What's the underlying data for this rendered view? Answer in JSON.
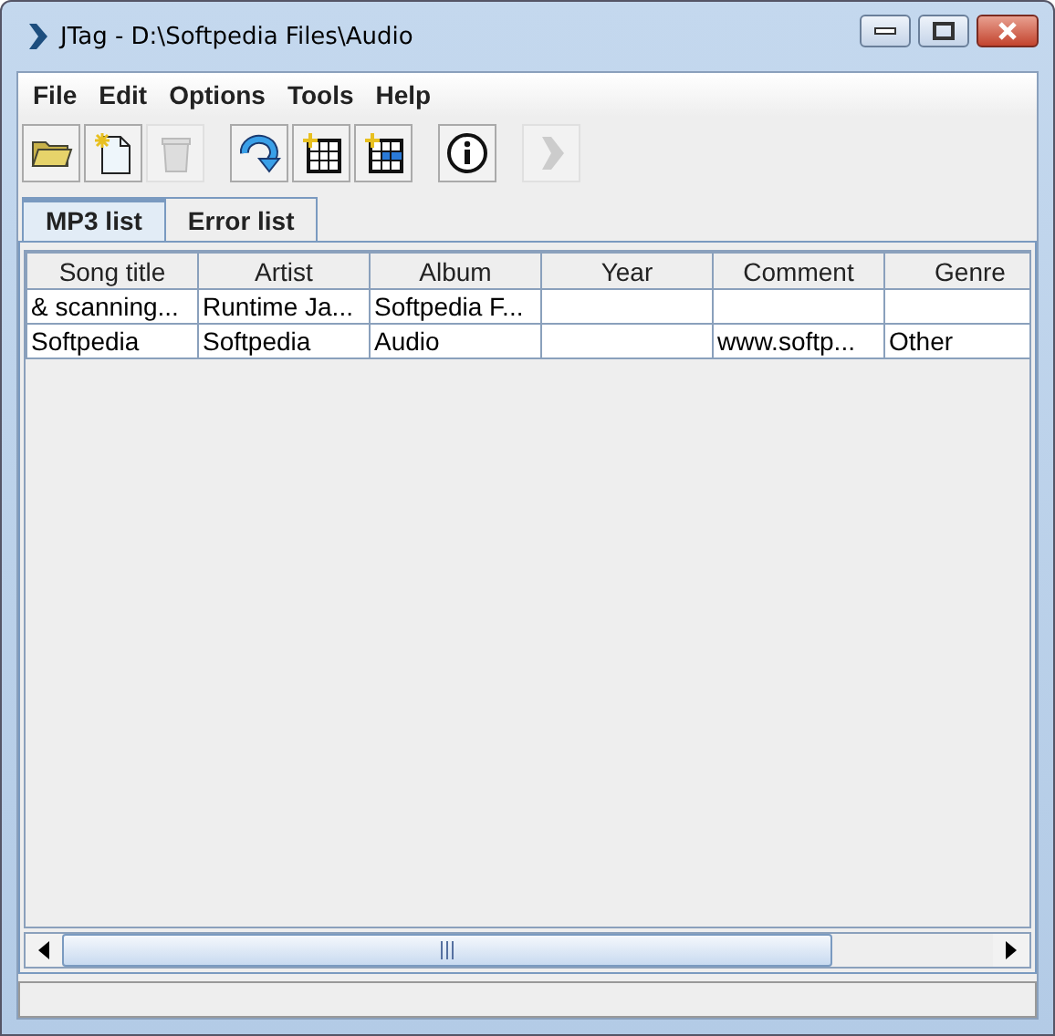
{
  "window": {
    "title": "JTag - D:\\Softpedia Files\\Audio"
  },
  "menu": [
    "File",
    "Edit",
    "Options",
    "Tools",
    "Help"
  ],
  "toolbar": [
    {
      "kind": "folder",
      "disabled": false
    },
    {
      "kind": "new-file",
      "disabled": false
    },
    {
      "kind": "trash",
      "disabled": true
    },
    {
      "kind": "refresh",
      "disabled": false
    },
    {
      "kind": "new-grid",
      "disabled": false
    },
    {
      "kind": "new-grid-blue",
      "disabled": false
    },
    {
      "kind": "info",
      "disabled": false
    },
    {
      "kind": "play",
      "disabled": true
    }
  ],
  "tabs": [
    {
      "label": "MP3 list",
      "selected": true
    },
    {
      "label": "Error list",
      "selected": false
    }
  ],
  "table": {
    "columns": [
      "Song title",
      "Artist",
      "Album",
      "Year",
      "Comment",
      "Genre"
    ],
    "rows": [
      [
        "& scanning...",
        "Runtime Ja...",
        "Softpedia F...",
        "",
        "",
        ""
      ],
      [
        "Softpedia",
        "Softpedia",
        "Audio",
        "",
        "www.softp...",
        "Other"
      ]
    ]
  }
}
